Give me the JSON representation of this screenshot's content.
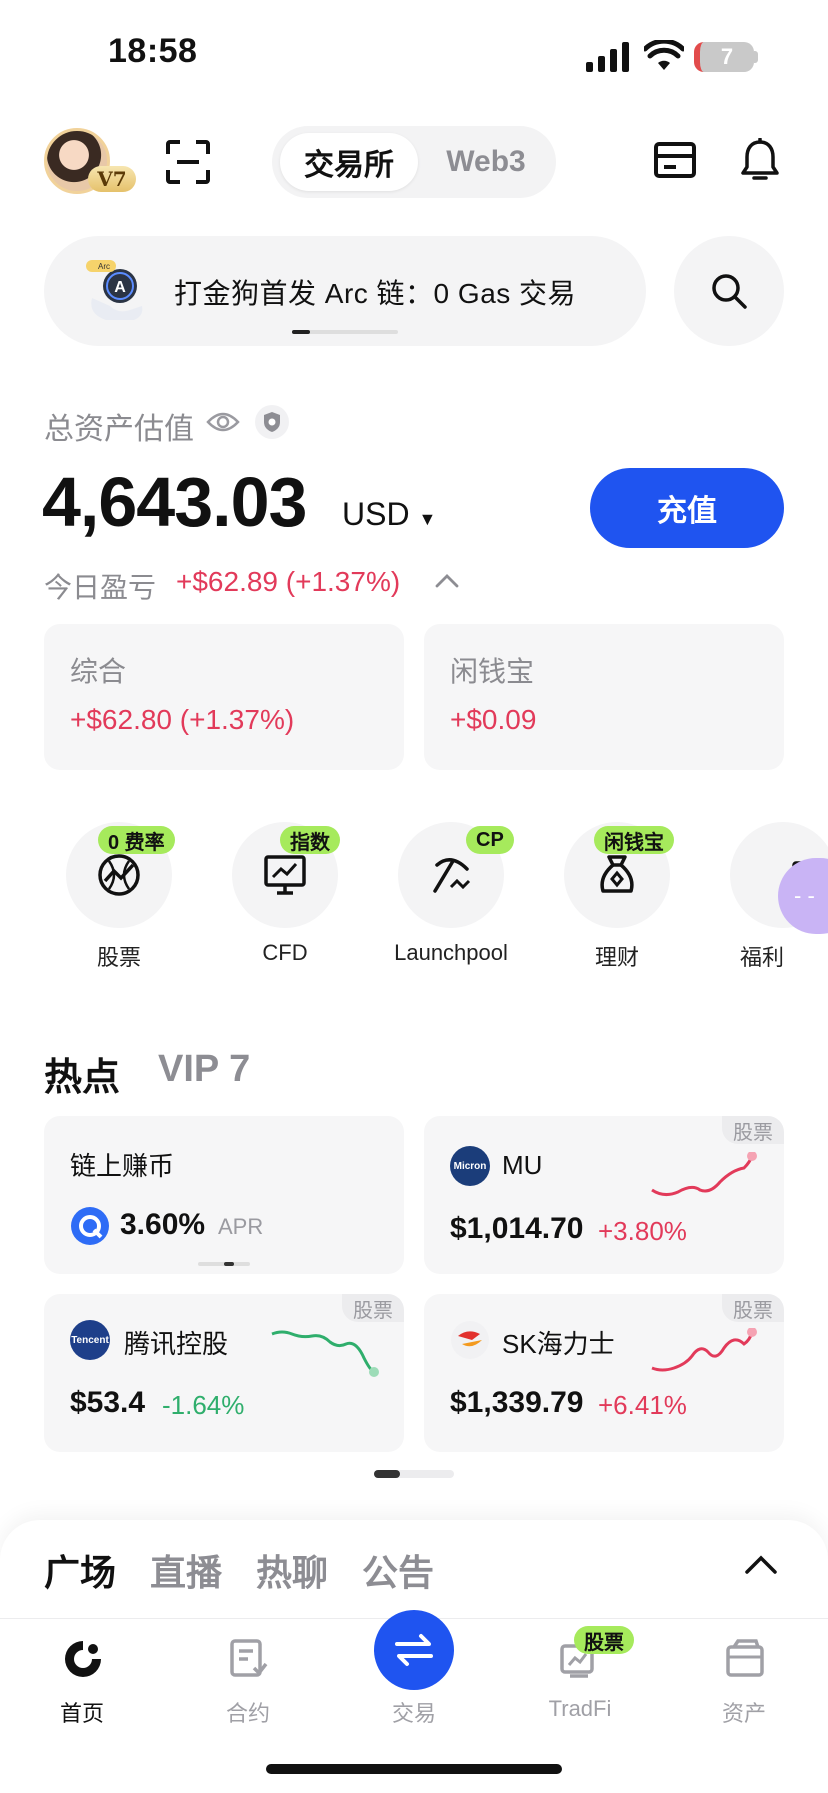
{
  "status_bar": {
    "time": "18:58",
    "battery": "7"
  },
  "header": {
    "vip_badge": "V7",
    "segments": [
      "交易所",
      "Web3"
    ],
    "active_segment": "交易所"
  },
  "banner": {
    "text": "打金狗首发 Arc 链：0 Gas 交易",
    "logo_tag": "Arc"
  },
  "assets": {
    "label": "总资产估值",
    "value": "4,643.03",
    "currency": "USD",
    "deposit_label": "充值",
    "today_pnl_label": "今日盈亏",
    "today_pnl_value": "+$62.89 (+1.37%)"
  },
  "sub_cards": [
    {
      "title": "综合",
      "value": "+$62.80 (+1.37%)"
    },
    {
      "title": "闲钱宝",
      "value": "+$0.09"
    }
  ],
  "shortcuts": [
    {
      "label": "股票",
      "tag": "0 费率",
      "icon": "globe-chart-icon"
    },
    {
      "label": "CFD",
      "tag": "指数",
      "icon": "monitor-chart-icon"
    },
    {
      "label": "Launchpool",
      "tag": "CP",
      "icon": "pickaxe-icon"
    },
    {
      "label": "理财",
      "tag": "闲钱宝",
      "icon": "money-bag-icon"
    },
    {
      "label": "福利",
      "tag": "",
      "icon": "gift-icon"
    }
  ],
  "hot": {
    "title": "热点",
    "vip_tab": "VIP 7",
    "cards": [
      {
        "name": "链上赚币",
        "value": "3.60%",
        "suffix": "APR",
        "tag": ""
      },
      {
        "name": "MU",
        "logo_text": "Micron",
        "price": "$1,014.70",
        "change": "+3.80%",
        "direction": "up",
        "tag": "股票"
      },
      {
        "name": "腾讯控股",
        "logo_text": "Tencent",
        "price": "$53.4",
        "change": "-1.64%",
        "direction": "down",
        "tag": "股票"
      },
      {
        "name": "SK海力士",
        "logo_text": "",
        "price": "$1,339.79",
        "change": "+6.41%",
        "direction": "up",
        "tag": "股票"
      }
    ]
  },
  "feed_tabs": [
    "广场",
    "直播",
    "热聊",
    "公告"
  ],
  "bottom_nav": {
    "items": [
      "首页",
      "合约",
      "交易",
      "TradFi",
      "资产"
    ],
    "tradfi_badge": "股票",
    "active": "首页"
  },
  "colors": {
    "accent": "#1f54f0",
    "up": "#e23a5a",
    "down": "#2fae6c",
    "tag_green": "#a6ea5c"
  }
}
